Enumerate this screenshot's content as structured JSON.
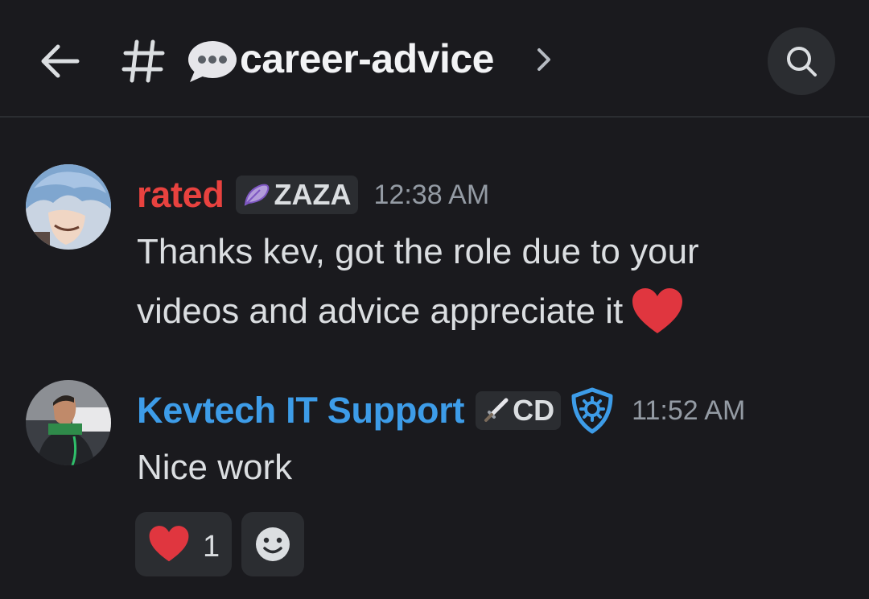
{
  "header": {
    "back_icon": "arrow-left-icon",
    "channel_icon": "hash-icon",
    "channel_emoji": "speech-balloon-icon",
    "channel_name": "career-advice",
    "chevron_icon": "chevron-right-icon",
    "search_icon": "search-icon"
  },
  "messages": [
    {
      "username": "rated",
      "username_color": "#e8423f",
      "tag_icon": "feather-icon",
      "tag": "ZAZA",
      "timestamp": "12:38 AM",
      "lines": [
        "Thanks kev, got the role due to your",
        "videos and advice appreciate it"
      ],
      "emoji": "red-heart-icon"
    },
    {
      "username": "Kevtech IT Support",
      "username_color": "#3d9ce8",
      "tag_icon": "sword-icon",
      "tag": "CD",
      "badge_icon": "shield-icon",
      "timestamp": "11:52 AM",
      "lines": [
        "Nice work"
      ],
      "reactions": [
        {
          "emoji": "red-heart-icon",
          "count": "1"
        }
      ],
      "add_reaction_icon": "smiley-add-icon"
    }
  ],
  "colors": {
    "background": "#1a1a1e",
    "pill": "#2b2d31",
    "heart": "#e0363f",
    "badge_blue": "#3d9ce8"
  }
}
